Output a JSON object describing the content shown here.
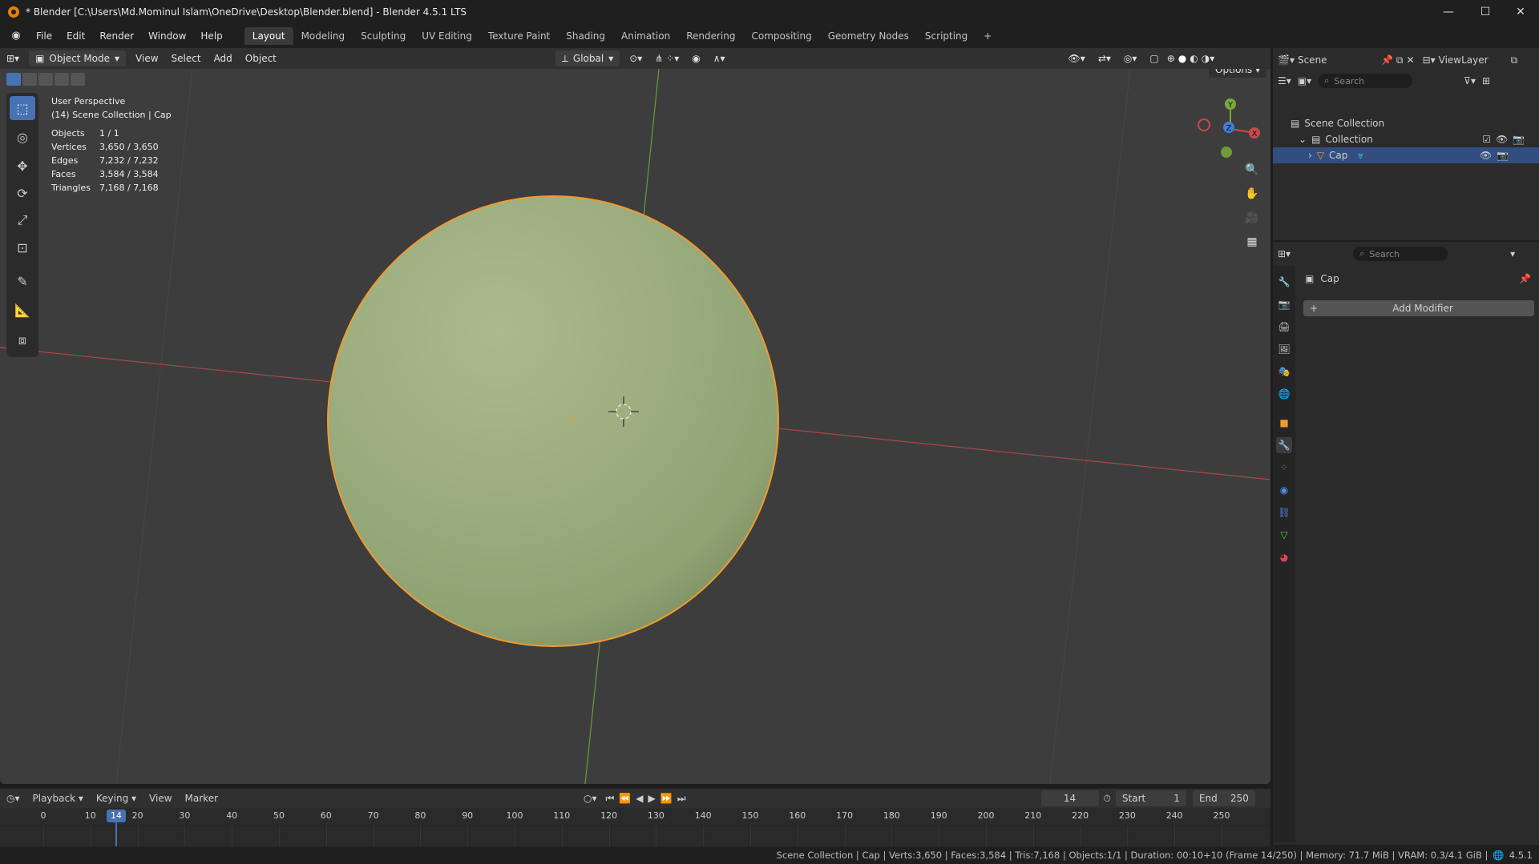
{
  "window": {
    "title": "* Blender [C:\\Users\\Md.Mominul Islam\\OneDrive\\Desktop\\Blender.blend] - Blender 4.5.1 LTS",
    "minimize": "—",
    "maximize": "☐",
    "close": "✕"
  },
  "menu": [
    "File",
    "Edit",
    "Render",
    "Window",
    "Help"
  ],
  "workspaces": [
    "Layout",
    "Modeling",
    "Sculpting",
    "UV Editing",
    "Texture Paint",
    "Shading",
    "Animation",
    "Rendering",
    "Compositing",
    "Geometry Nodes",
    "Scripting"
  ],
  "workspace_add": "+",
  "viewport_header": {
    "mode": "Object Mode",
    "menus": [
      "View",
      "Select",
      "Add",
      "Object"
    ],
    "transform": "Global",
    "options": "Options"
  },
  "viewport_info": {
    "perspective": "User Perspective",
    "context": "(14) Scene Collection | Cap"
  },
  "stats": [
    {
      "k": "Objects",
      "v": "1 / 1"
    },
    {
      "k": "Vertices",
      "v": "3,650 / 3,650"
    },
    {
      "k": "Edges",
      "v": "7,232 / 7,232"
    },
    {
      "k": "Faces",
      "v": "3,584 / 3,584"
    },
    {
      "k": "Triangles",
      "v": "7,168 / 7,168"
    }
  ],
  "gizmo": {
    "x": "X",
    "y": "Y",
    "z": "Z"
  },
  "top_right": {
    "scene": "Scene",
    "viewlayer": "ViewLayer"
  },
  "outliner": {
    "search": "Search",
    "root": "Scene Collection",
    "collection": "Collection",
    "object": "Cap"
  },
  "properties": {
    "search": "Search",
    "object": "Cap",
    "add_modifier": "Add Modifier"
  },
  "timeline": {
    "menus": [
      "Playback",
      "Keying",
      "View",
      "Marker"
    ],
    "current_frame": "14",
    "start_label": "Start",
    "start": "1",
    "end_label": "End",
    "end": "250",
    "ticks": [
      "0",
      "10",
      "20",
      "30",
      "40",
      "50",
      "60",
      "70",
      "80",
      "90",
      "100",
      "110",
      "120",
      "130",
      "140",
      "150",
      "160",
      "170",
      "180",
      "190",
      "200",
      "210",
      "220",
      "230",
      "240",
      "250"
    ],
    "playhead": "14"
  },
  "statusbar": {
    "text": "Scene Collection | Cap | Verts:3,650 | Faces:3,584 | Tris:7,168 | Objects:1/1 | Duration: 00:10+10 (Frame 14/250) | Memory: 71.7 MiB | VRAM: 0.3/4.1 GiB |",
    "version": "4.5.1"
  },
  "colors": {
    "accent": "#4772b3",
    "selection": "#f29a2e",
    "axis_x": "#c84a4a",
    "axis_y": "#7aa83a",
    "axis_z": "#3f7fd9"
  }
}
